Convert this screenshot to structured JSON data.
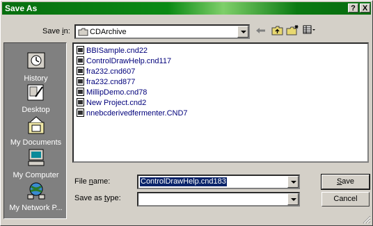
{
  "window": {
    "title": "Save As",
    "help_btn": "?",
    "close_btn": "X"
  },
  "save_in": {
    "label_pre": "Save ",
    "label_u": "i",
    "label_post": "n:",
    "value": "CDArchive"
  },
  "places": [
    {
      "label": "History",
      "icon": "history-icon"
    },
    {
      "label": "Desktop",
      "icon": "desktop-icon"
    },
    {
      "label": "My Documents",
      "icon": "my-documents-icon"
    },
    {
      "label": "My Computer",
      "icon": "my-computer-icon"
    },
    {
      "label": "My Network P...",
      "icon": "my-network-places-icon"
    }
  ],
  "files": [
    "BBISample.cnd22",
    "ControlDrawHelp.cnd117",
    "fra232.cnd607",
    "fra232.cnd877",
    "MillipDemo.cnd78",
    "New Project.cnd2",
    "nnebcderivedfermenter.CND7"
  ],
  "filename": {
    "label_pre": "File ",
    "label_u": "n",
    "label_post": "ame:",
    "value": "ControlDrawHelp.cnd183"
  },
  "savetype": {
    "label_pre": "Save as ",
    "label_u": "t",
    "label_post": "ype:",
    "value": ""
  },
  "buttons": {
    "save_u": "S",
    "save_rest": "ave",
    "cancel": "Cancel"
  }
}
